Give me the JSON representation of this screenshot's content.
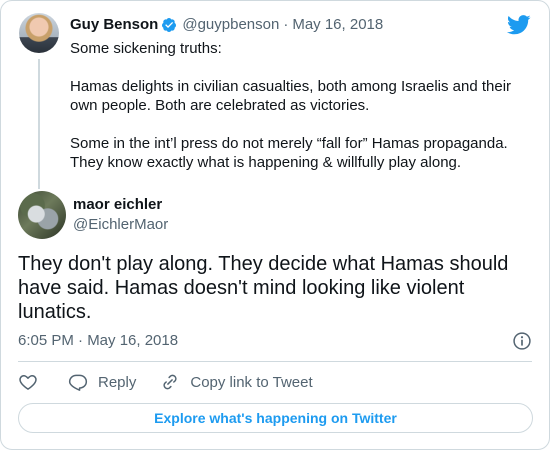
{
  "parent_tweet": {
    "name": "Guy Benson",
    "handle": "@guypbenson",
    "separator": "·",
    "date": "May 16, 2018",
    "paragraphs": [
      "Some sickening truths:",
      "Hamas delights in civilian casualties, both among Israelis and their own people. Both are celebrated as victories.",
      "Some in the int’l press do not merely “fall for” Hamas propaganda. They know exactly what is happening & willfully play along."
    ]
  },
  "reply_tweet": {
    "name": "maor eichler",
    "handle": "@EichlerMaor",
    "text": "They don't play along. They decide what Hamas should have said. Hamas doesn't mind looking like violent lunatics.",
    "timestamp": "6:05 PM · May 16, 2018"
  },
  "actions": {
    "reply_label": "Reply",
    "copy_link_label": "Copy link to Tweet"
  },
  "explore_button": "Explore what's happening on Twitter",
  "colors": {
    "brand_blue": "#1d9bf0",
    "text_primary": "#0f1419",
    "text_secondary": "#536471",
    "border": "#cfd9de"
  },
  "icons": [
    "verified-badge-icon",
    "twitter-bird-icon",
    "info-icon",
    "heart-icon",
    "reply-bubble-icon",
    "link-icon"
  ]
}
